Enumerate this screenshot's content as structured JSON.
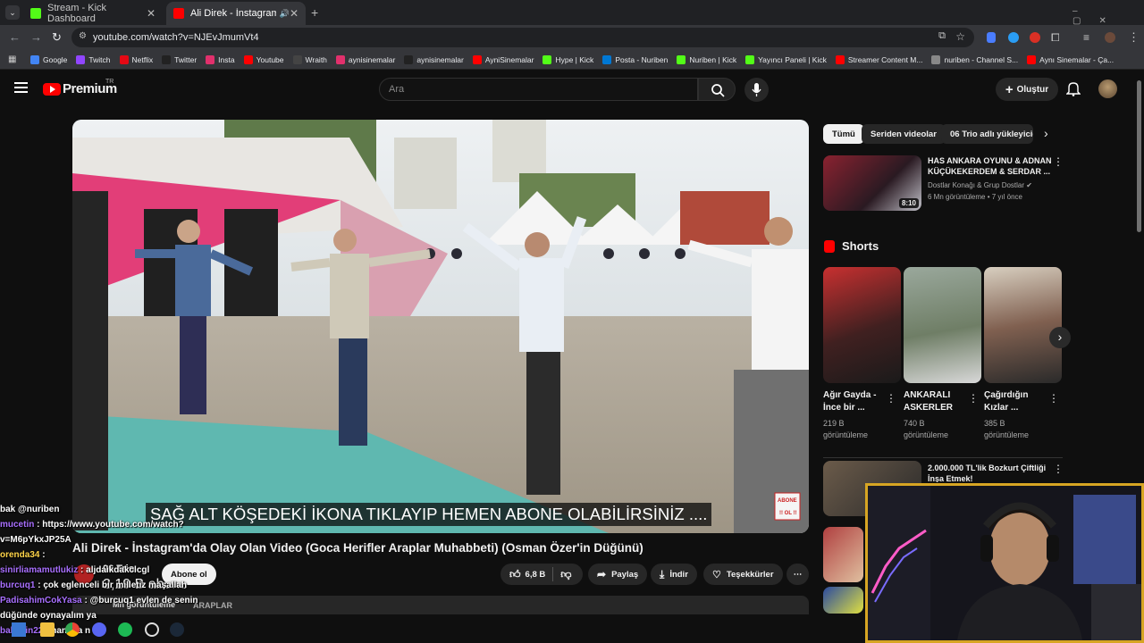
{
  "browser": {
    "tabs": [
      {
        "title": "Stream - Kick Dashboard",
        "color": "#53fc18"
      },
      {
        "title": "Ali Direk - İnstagram'da Ol",
        "color": "#ff0000"
      }
    ],
    "url": "youtube.com/watch?v=NJEvJmumVt4",
    "bookmarks": [
      {
        "label": "Google",
        "color": "#4285f4"
      },
      {
        "label": "Twitch",
        "color": "#9146ff"
      },
      {
        "label": "Netflix",
        "color": "#e50914"
      },
      {
        "label": "Twitter",
        "color": "#222222"
      },
      {
        "label": "Insta",
        "color": "#e1306c"
      },
      {
        "label": "Youtube",
        "color": "#ff0000"
      },
      {
        "label": "Wraith",
        "color": "#444444"
      },
      {
        "label": "aynisinemalar",
        "color": "#e1306c"
      },
      {
        "label": "aynisinemalar",
        "color": "#222222"
      },
      {
        "label": "AyniSinemalar",
        "color": "#ff0000"
      },
      {
        "label": "Hype | Kick",
        "color": "#53fc18"
      },
      {
        "label": "Posta - Nuriben",
        "color": "#0078d4"
      },
      {
        "label": "Nuriben | Kick",
        "color": "#53fc18"
      },
      {
        "label": "Yayıncı Paneli | Kick",
        "color": "#53fc18"
      },
      {
        "label": "Streamer Content M...",
        "color": "#ff0000"
      },
      {
        "label": "nuriben - Channel S...",
        "color": "#888888"
      },
      {
        "label": "Aynı Sinemalar - Ça...",
        "color": "#ff0000"
      }
    ]
  },
  "youtube": {
    "logo_text": "Premium",
    "logo_sup": "TR",
    "search_placeholder": "Ara",
    "create_label": "Oluştur",
    "accent": "#ff0000"
  },
  "video": {
    "caption": "SAĞ ALT KÖŞEDEKİ İKONA TIKLAYIP HEMEN ABONE OLABİLİRSİNİZ ....",
    "watermark": "ABONE\nOL !!",
    "title": "Ali Direk - İnstagram'da Olay Olan Video (Goca Herifler Araplar Muhabbeti) (Osman Özer'in Düğünü)",
    "channel": "06 Trio",
    "subs": "2,19 B abone",
    "subscribe_label": "Abone ol",
    "likes": "6,8 B",
    "share_label": "Paylaş",
    "download_label": "İndir",
    "thanks_label": "Teşekkürler",
    "desc_prefix": "Mn görüntüleme",
    "desc_suffix": "ARAPLAR"
  },
  "sidebar": {
    "chips": [
      "Tümü",
      "Seriden videolar",
      "06 Trio adlı yükleyicid"
    ],
    "top_video": {
      "title": "HAS ANKARA OYUNU & ADNAN KÜÇÜKEKERDEM & SERDAR ...",
      "channel": "Dostlar Konağı & Grup Dostlar",
      "meta": "6 Mn görüntüleme • 7 yıl önce",
      "duration": "8:10"
    },
    "shorts_label": "Shorts",
    "shorts": [
      {
        "title": "Ağır Gayda - İnce bir ...",
        "views": "219 B",
        "views_label": "görüntüleme"
      },
      {
        "title": "ANKARALI ASKERLER",
        "views": "740 B",
        "views_label": "görüntüleme"
      },
      {
        "title": "Çağırdığın Kızlar ...",
        "views": "385 B",
        "views_label": "görüntüleme"
      }
    ],
    "next_video": {
      "title": "2.000.000 TL'lik Bozkurt Çiftliği İnşa Etmek!"
    }
  },
  "chat": [
    {
      "user": "bak @nuriben",
      "msg": "",
      "color": "#ffffff"
    },
    {
      "user": "mucetin",
      "msg": ": https://www.youtube.com/watch?",
      "color": "#a970ff"
    },
    {
      "user": "v=M6pYkxJP25A",
      "msg": "",
      "color": "#ffffff"
    },
    {
      "user": "orenda34",
      "msg": ":",
      "color": "#ffd54a"
    },
    {
      "user": "sinirliamamutlukiz",
      "msg": ": aljdaikdakclcgl",
      "color": "#a970ff"
    },
    {
      "user": "burcuq1",
      "msg": ": çok eglenceli bir milletiz maşallah",
      "color": "#a970ff"
    },
    {
      "user": "PadisahimCokYasa",
      "msg": ": @burcuq1 evlen de senin",
      "color": "#a970ff"
    },
    {
      "user": "düğünde oynayalım ya",
      "msg": "",
      "color": "#ffffff"
    },
    {
      "user": "baldwin22",
      "msg": ": hanima n",
      "color": "#a970ff"
    }
  ]
}
